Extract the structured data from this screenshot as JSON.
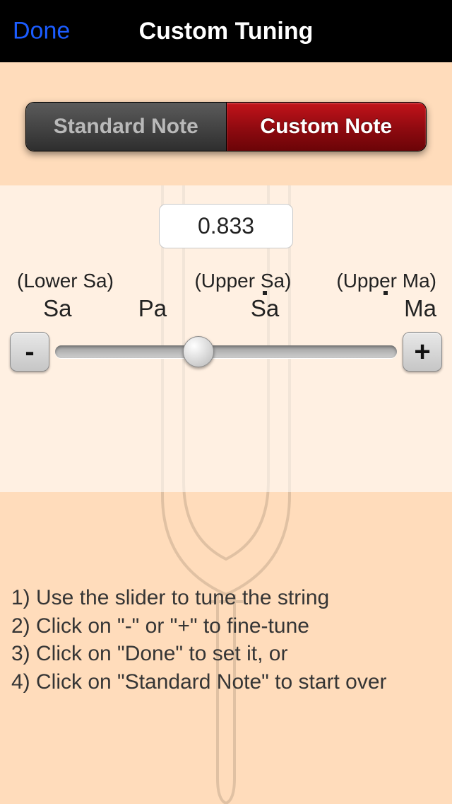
{
  "navbar": {
    "done_label": "Done",
    "title": "Custom Tuning"
  },
  "segmented": {
    "standard_label": "Standard Note",
    "custom_label": "Custom Note",
    "selected": "custom"
  },
  "tuning": {
    "value": "0.833",
    "upper_labels": {
      "lower_sa": "(Lower Sa)",
      "upper_sa": "(Upper Sa)",
      "upper_ma": "(Upper Ma)"
    },
    "marks": {
      "sa": "Sa",
      "pa": "Pa",
      "sa_upper": "Sa",
      "ma_upper": "Ma"
    },
    "minus_label": "-",
    "plus_label": "+",
    "slider_position_pct": 42
  },
  "instructions": {
    "line1": "1) Use the slider to tune the string",
    "line2": "2) Click on \"-\" or \"+\" to fine-tune",
    "line3": "3) Click on \"Done\" to set it, or",
    "line4": "4) Click on \"Standard Note\" to start over"
  }
}
